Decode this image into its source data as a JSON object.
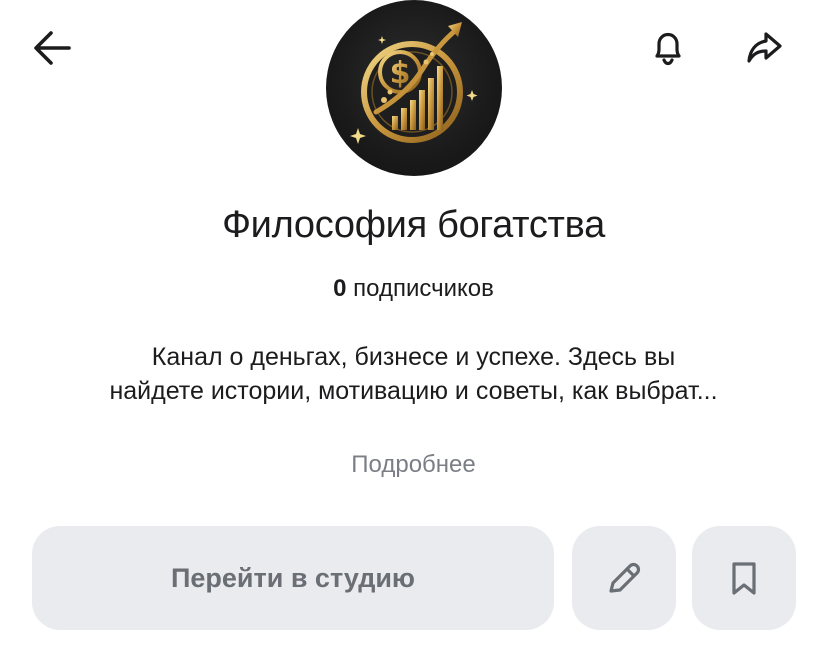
{
  "header": {
    "back_icon": "arrow-left-icon",
    "bell_icon": "bell-icon",
    "share_icon": "share-forward-icon"
  },
  "channel": {
    "title": "Философия богатства",
    "subscribers_count": "0",
    "subscribers_label": "подписчиков",
    "description_line1": "Канал о деньгах, бизнесе и успехе. Здесь вы",
    "description_line2": "найдете истории, мотивацию и советы, как выбрат...",
    "more_label": "Подробнее"
  },
  "actions": {
    "studio_label": "Перейти в студию",
    "edit_icon": "pencil-icon",
    "bookmark_icon": "bookmark-icon"
  },
  "colors": {
    "button_bg": "#eaebef",
    "muted_text": "#7b7f85",
    "primary_text": "#1c1c1e",
    "avatar_gold": "#d4a94a"
  }
}
